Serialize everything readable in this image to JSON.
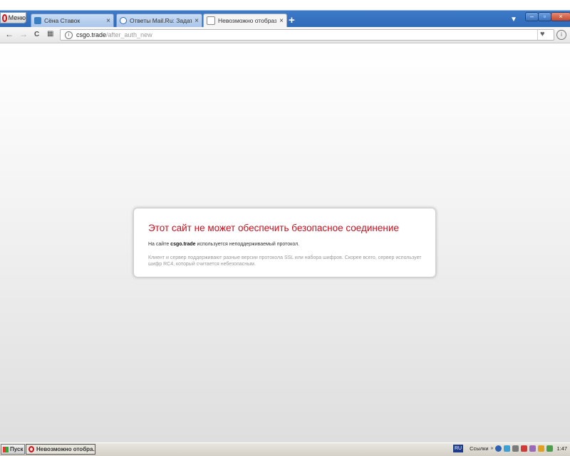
{
  "browser": {
    "menu_label": "Меню",
    "tabs": [
      {
        "title": "Сёна Ставок",
        "close": "×",
        "active": false,
        "favicon_color": "#3a7fc1"
      },
      {
        "title": "Ответы Mail.Ru: Задать во",
        "close": "×",
        "active": false,
        "favicon_color": "#2b6bb8"
      },
      {
        "title": "Невозможно отобразить стр",
        "close": "×",
        "active": true,
        "favicon_color": "#888888"
      }
    ],
    "new_tab": "+",
    "window_controls": {
      "minimize": "–",
      "maximize": "▫",
      "close": "×"
    }
  },
  "toolbar": {
    "back": "←",
    "forward": "→",
    "reload": "C",
    "speed_dial": "▦",
    "url_host": "csgo.trade",
    "url_path": "/after_auth_new"
  },
  "error": {
    "title": "Этот сайт не может обеспечить безопасное соединение",
    "sub_prefix": "На сайте",
    "sub_host": "csgo.trade",
    "sub_suffix": "используется неподдерживаемый протокол.",
    "detail": "Клиент и сервер поддерживают разные версии протокола SSL или набора шифров. Скорее всего, сервер использует шифр RC4, который считается небезопасным.",
    "accent_color": "#c1121f"
  },
  "taskbar": {
    "start_label": "Пуск",
    "task_label": "Невозможно отобра...",
    "lang": "RU",
    "links_label": "Ссылки",
    "clock": "1:47"
  }
}
